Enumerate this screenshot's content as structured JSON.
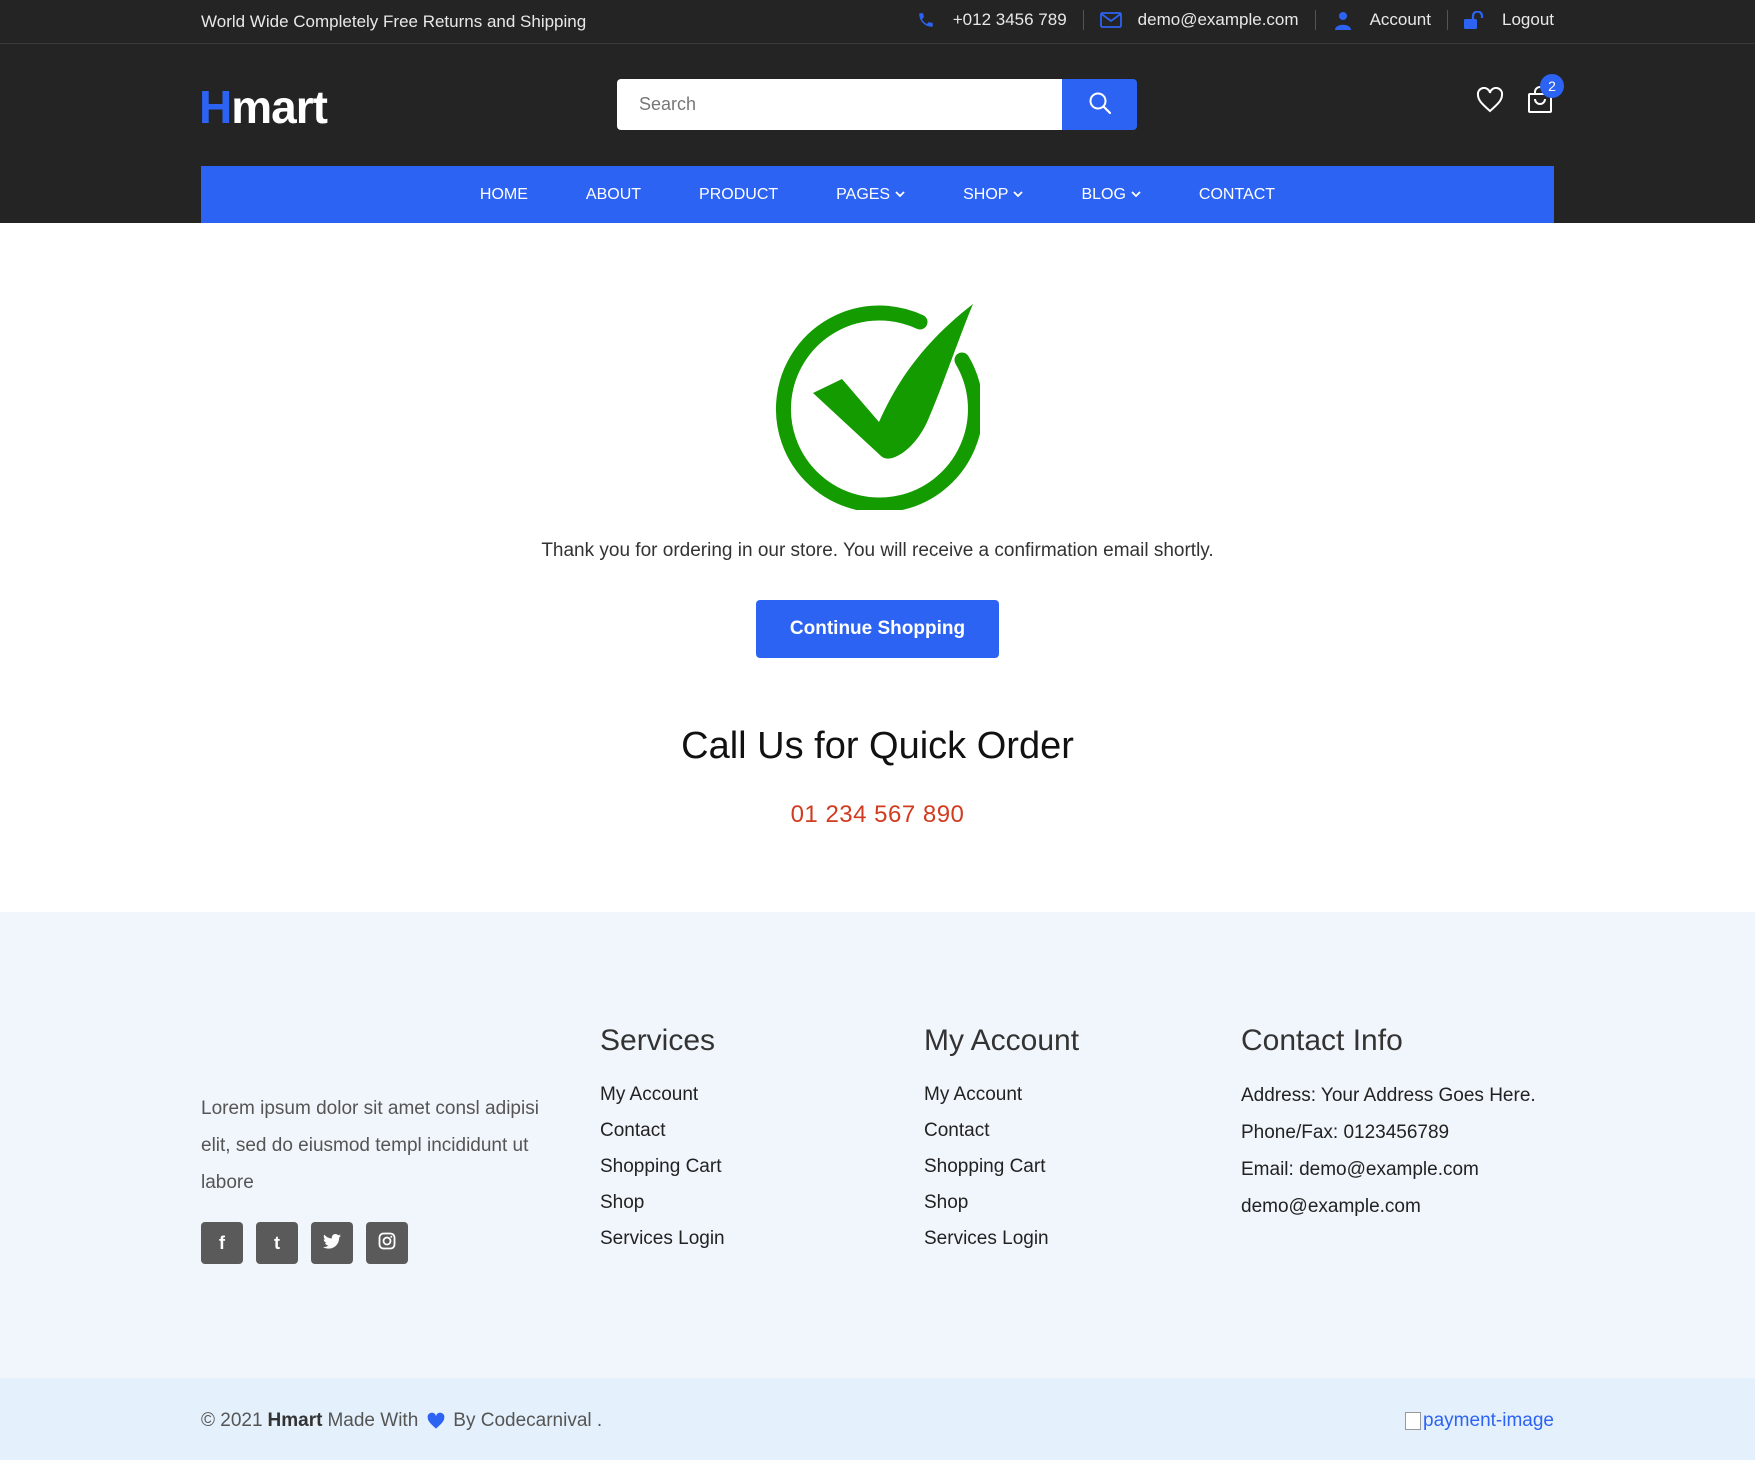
{
  "topbar": {
    "promo": "World Wide Completely Free Returns and Shipping",
    "phone": "+012 3456 789",
    "email": "demo@example.com",
    "account": "Account",
    "logout": "Logout"
  },
  "header": {
    "logo_h": "H",
    "logo_rest": "mart",
    "search_placeholder": "Search",
    "cart_count": "2"
  },
  "nav": {
    "items": [
      {
        "label": "HOME"
      },
      {
        "label": "ABOUT"
      },
      {
        "label": "PRODUCT"
      },
      {
        "label": "PAGES"
      },
      {
        "label": "SHOP"
      },
      {
        "label": "BLOG"
      },
      {
        "label": "CONTACT"
      }
    ]
  },
  "main": {
    "thanks": "Thank you for ordering in our store. You will receive a confirmation email shortly.",
    "continue_label": "Continue Shopping",
    "call_title": "Call Us for Quick Order",
    "call_phone": "01 234 567 890"
  },
  "footer": {
    "about": "Lorem ipsum dolor sit amet consl adipisi elit, sed do eiusmod templ incididunt ut labore",
    "socials": [
      "f",
      "t",
      "twitter",
      "instagram"
    ],
    "services": {
      "title": "Services",
      "links": [
        "My Account",
        "Contact",
        "Shopping Cart",
        "Shop",
        "Services Login"
      ]
    },
    "account": {
      "title": "My Account",
      "links": [
        "My Account",
        "Contact",
        "Shopping Cart",
        "Shop",
        "Services Login"
      ]
    },
    "contact": {
      "title": "Contact Info",
      "address": "Address: Your Address Goes Here.",
      "phone": "Phone/Fax: 0123456789",
      "email": "Email: demo@example.com",
      "email2": "demo@example.com"
    }
  },
  "copyright": {
    "prefix": "© 2021",
    "brand": "Hmart",
    "made_with": "Made With",
    "by": "By Codecarnival .",
    "payment_alt": "payment-image"
  },
  "colors": {
    "primary": "#2d63f2",
    "dark": "#242424",
    "success": "#149b00",
    "phone": "#d13b20"
  }
}
